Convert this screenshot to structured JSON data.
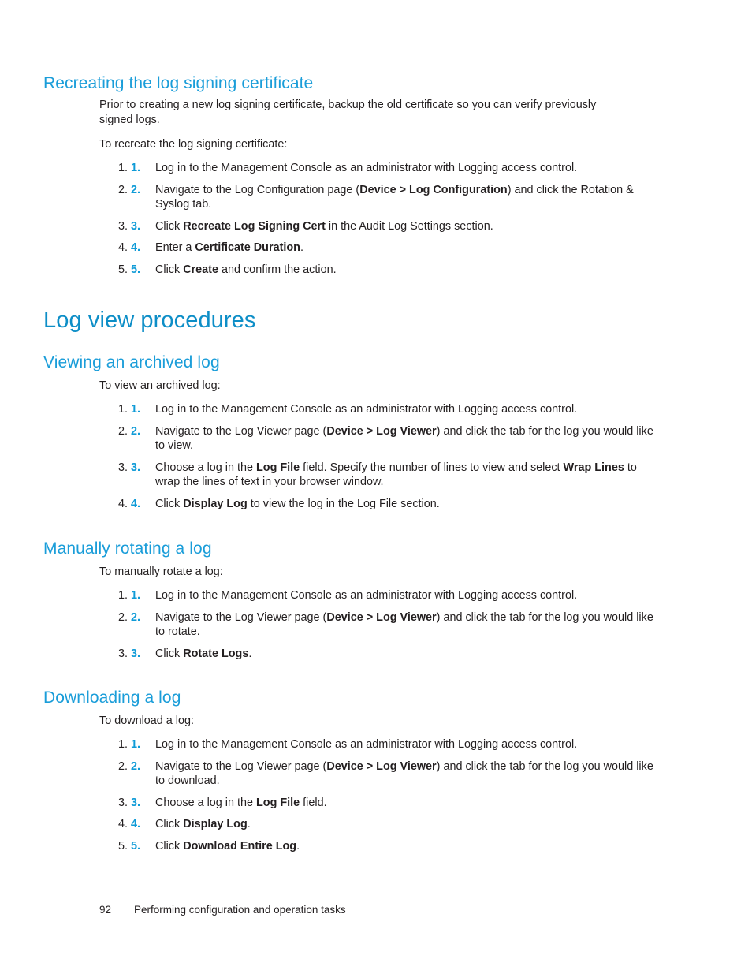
{
  "page": {
    "number": "92",
    "footer_text": "Performing configuration and operation tasks"
  },
  "colors": {
    "heading_h1": "#0d8ec7",
    "heading_h2": "#1a9dd9",
    "list_number": "#0f9bd7",
    "body_text": "#231f20",
    "background": "#ffffff"
  },
  "sections": [
    {
      "id": "recreating-log-signing-certificate",
      "level": "h2",
      "title": "Recreating the log signing certificate",
      "paragraphs": [
        "Prior to creating a new log signing certificate, backup the old certificate so you can verify previously signed logs.",
        "To recreate the log signing certificate:"
      ],
      "steps": [
        {
          "num": "1.",
          "html": "Log in to the Management Console as an administrator with Logging access control."
        },
        {
          "num": "2.",
          "html": "Navigate to the Log Configuration page (<b>Device &gt; Log Configuration</b>) and click the Rotation &amp; Syslog tab."
        },
        {
          "num": "3.",
          "html": "Click <b>Recreate Log Signing Cert</b> in the Audit Log Settings section."
        },
        {
          "num": "4.",
          "html": "Enter a <b>Certificate Duration</b>."
        },
        {
          "num": "5.",
          "html": "Click <b>Create</b> and confirm the action."
        }
      ]
    },
    {
      "id": "log-view-procedures",
      "level": "h1",
      "title": "Log view procedures"
    },
    {
      "id": "viewing-an-archived-log",
      "level": "h2",
      "title": "Viewing an archived log",
      "paragraphs": [
        "To view an archived log:"
      ],
      "steps": [
        {
          "num": "1.",
          "html": "Log in to the Management Console as an administrator with Logging access control."
        },
        {
          "num": "2.",
          "html": "Navigate to the Log Viewer page (<b>Device &gt; Log Viewer</b>) and click the tab for the log you would like to view."
        },
        {
          "num": "3.",
          "html": "Choose a log in the <b>Log File</b> field. Specify the number of lines to view and select <b>Wrap Lines</b> to wrap the lines of text in your browser window."
        },
        {
          "num": "4.",
          "html": "Click <b>Display Log</b> to view the log in the Log File section."
        }
      ]
    },
    {
      "id": "manually-rotating-a-log",
      "level": "h2",
      "title": "Manually rotating a log",
      "paragraphs": [
        "To manually rotate a log:"
      ],
      "steps": [
        {
          "num": "1.",
          "html": "Log in to the Management Console as an administrator with Logging access control."
        },
        {
          "num": "2.",
          "html": "Navigate to the Log Viewer page (<b>Device &gt; Log Viewer</b>) and click the tab for the log you would like to rotate."
        },
        {
          "num": "3.",
          "html": "Click <b>Rotate Logs</b>."
        }
      ]
    },
    {
      "id": "downloading-a-log",
      "level": "h2",
      "title": "Downloading a log",
      "paragraphs": [
        "To download a log:"
      ],
      "steps": [
        {
          "num": "1.",
          "html": "Log in to the Management Console as an administrator with Logging access control."
        },
        {
          "num": "2.",
          "html": "Navigate to the Log Viewer page (<b>Device &gt; Log Viewer</b>) and click the tab for the log you would like to download."
        },
        {
          "num": "3.",
          "html": "Choose a log in the <b>Log File</b> field."
        },
        {
          "num": "4.",
          "html": "Click <b>Display Log</b>."
        },
        {
          "num": "5.",
          "html": "Click <b>Download Entire Log</b>."
        }
      ]
    }
  ]
}
